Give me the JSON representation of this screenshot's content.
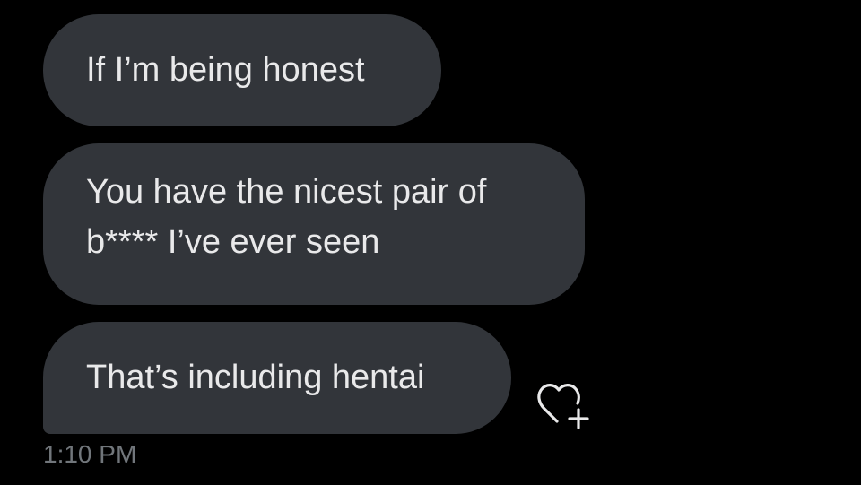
{
  "conversation": {
    "messages": [
      {
        "lines": [
          "If I’m being honest"
        ]
      },
      {
        "lines": [
          "You have the nicest pair of",
          "b**** I’ve ever seen"
        ]
      },
      {
        "lines": [
          "That’s including hentai"
        ]
      }
    ],
    "timestamp": "1:10 PM"
  },
  "icons": {
    "react": "heart-plus-icon"
  },
  "colors": {
    "background": "#000000",
    "bubble": "#32353a",
    "text": "#e9e9ea",
    "muted": "#71767b"
  }
}
